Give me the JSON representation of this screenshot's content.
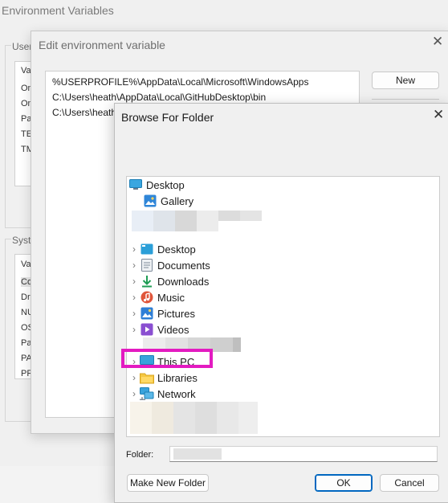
{
  "env_window": {
    "title": "Environment Variables",
    "user_group_label": "User",
    "user_list_peek": [
      "Va",
      "On",
      "On",
      "Pa",
      "TE",
      "TM"
    ],
    "system_group_label": "Syste",
    "system_list_peek": [
      "Va",
      "Co",
      "Dr",
      "NU",
      "OS",
      "Pa",
      "PA",
      "PR"
    ]
  },
  "edit_window": {
    "title": "Edit environment variable",
    "close_glyph": "✕",
    "paths": [
      "%USERPROFILE%\\AppData\\Local\\Microsoft\\WindowsApps",
      "C:\\Users\\heath\\AppData\\Local\\GitHubDesktop\\bin",
      "C:\\Users\\heath"
    ],
    "new_label": "New"
  },
  "browse_window": {
    "title": "Browse For Folder",
    "close_glyph": "✕",
    "tree": {
      "root": {
        "label": "Desktop",
        "icon": "desktop-icon"
      },
      "gallery": {
        "label": "Gallery",
        "icon": "gallery-icon"
      },
      "items": [
        {
          "label": "Desktop",
          "icon": "desktop-folder-icon",
          "color": "#2b9fd8"
        },
        {
          "label": "Documents",
          "icon": "documents-icon",
          "color": "#7d8a99"
        },
        {
          "label": "Downloads",
          "icon": "downloads-icon",
          "color": "#1f9d55"
        },
        {
          "label": "Music",
          "icon": "music-icon",
          "color": "#e0563b"
        },
        {
          "label": "Pictures",
          "icon": "pictures-icon",
          "color": "#2f7fd6"
        },
        {
          "label": "Videos",
          "icon": "videos-icon",
          "color": "#8a4fd1"
        }
      ],
      "this_pc": {
        "label": "This PC",
        "icon": "this-pc-icon"
      },
      "libraries": {
        "label": "Libraries",
        "icon": "libraries-icon"
      },
      "network": {
        "label": "Network",
        "icon": "network-icon"
      }
    },
    "chevron_glyph": "›",
    "folder_label": "Folder:",
    "folder_value": "",
    "make_new_folder_label": "Make New Folder",
    "ok_label": "OK",
    "cancel_label": "Cancel",
    "highlight_color": "#e31bc1"
  }
}
